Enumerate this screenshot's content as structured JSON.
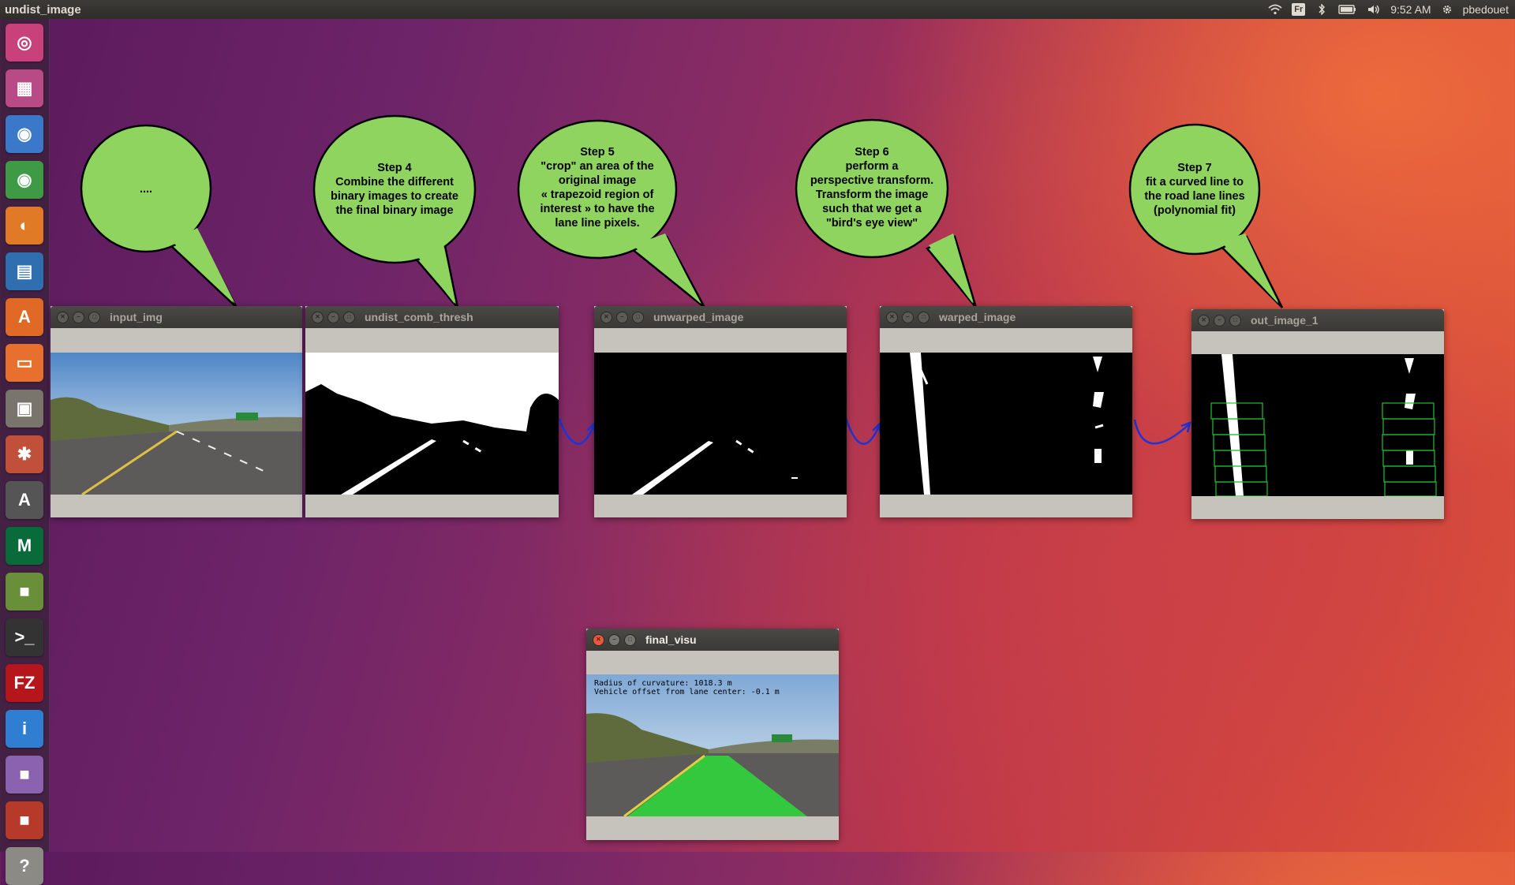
{
  "top_panel": {
    "app_title": "undist_image",
    "keyboard_layout": "Fr",
    "time": "9:52 AM",
    "user": "pbedouet"
  },
  "launcher": {
    "items": [
      {
        "name": "dash",
        "icon": "ubuntu-logo-icon",
        "color": "#c8417a"
      },
      {
        "name": "workspaces",
        "icon": "workspace-switcher-icon",
        "color": "#b84a86"
      },
      {
        "name": "chromium",
        "icon": "chromium-icon",
        "color": "#3b78c9"
      },
      {
        "name": "chrome",
        "icon": "chrome-icon",
        "color": "#3f9a46"
      },
      {
        "name": "firefox",
        "icon": "firefox-icon",
        "color": "#e07a26"
      },
      {
        "name": "writer",
        "icon": "libreoffice-writer-icon",
        "color": "#2f6fb0"
      },
      {
        "name": "software-center",
        "icon": "ubuntu-software-icon",
        "color": "#e06a25"
      },
      {
        "name": "files",
        "icon": "files-icon",
        "color": "#e8702f"
      },
      {
        "name": "archive",
        "icon": "archive-manager-icon",
        "color": "#7a756c"
      },
      {
        "name": "system-settings",
        "icon": "system-settings-icon",
        "color": "#c0503a"
      },
      {
        "name": "software-updater",
        "icon": "software-updater-icon",
        "color": "#555"
      },
      {
        "name": "matlab",
        "icon": "matlab-icon",
        "color": "#0a6b3a"
      },
      {
        "name": "app-green",
        "icon": "app-icon",
        "color": "#6a8f3a"
      },
      {
        "name": "terminal",
        "icon": "terminal-icon",
        "color": "#333"
      },
      {
        "name": "filezilla",
        "icon": "filezilla-icon",
        "color": "#b5161b"
      },
      {
        "name": "intel",
        "icon": "intel-icon",
        "color": "#2f7ed1"
      },
      {
        "name": "app-purple",
        "icon": "app-icon",
        "color": "#8a62b0"
      },
      {
        "name": "app-red",
        "icon": "app-icon",
        "color": "#b63a2a"
      },
      {
        "name": "help",
        "icon": "help-icon",
        "color": "#8c8a85"
      }
    ]
  },
  "windows": {
    "input_img": "input_img",
    "undist_comb_thresh": "undist_comb_thresh",
    "unwarped_image": "unwarped_image",
    "warped_image": "warped_image",
    "out_image_1": "out_image_1",
    "final_visu": "final_visu"
  },
  "final_visu_caption": {
    "line1": "Radius of curvature: 1018.3 m",
    "line2": "Vehicle offset from lane center: -0.1 m"
  },
  "bubbles": {
    "b1": [
      "...."
    ],
    "b4": [
      "Step 4",
      "Combine the different",
      "binary images to create",
      "the final binary image"
    ],
    "b5": [
      "Step 5",
      "\"crop\" an area of the",
      "original image",
      "« trapezoid region of",
      "interest » to have the",
      "lane line pixels."
    ],
    "b6": [
      "Step 6",
      "perform a",
      "perspective transform.",
      "Transform the image",
      "such that we get a",
      "\"bird's eye view\""
    ],
    "b7": [
      "Step 7",
      "fit a curved line to",
      "the road lane lines",
      "(polynomial fit)"
    ]
  },
  "colors": {
    "bubble_fill": "#8fd45e",
    "arrow": "#1f33d6",
    "lane_overlay": "#2fd43a",
    "window_frame": "#c6c3bd"
  }
}
